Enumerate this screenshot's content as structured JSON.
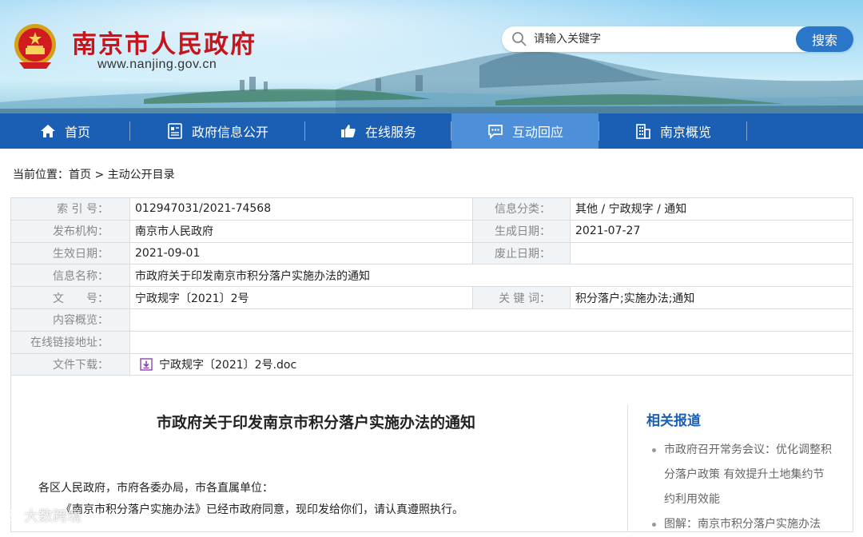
{
  "header": {
    "site_title": "南京市人民政府",
    "site_url": "www.nanjing.gov.cn",
    "search_placeholder": "请输入关键字",
    "search_button": "搜索"
  },
  "nav": {
    "items": [
      {
        "label": "首页",
        "icon": "home-icon"
      },
      {
        "label": "政府信息公开",
        "icon": "document-icon"
      },
      {
        "label": "在线服务",
        "icon": "thumbs-up-icon"
      },
      {
        "label": "互动回应",
        "icon": "chat-icon"
      },
      {
        "label": "南京概览",
        "icon": "building-icon"
      }
    ],
    "active_index": 3
  },
  "breadcrumb": {
    "prefix": "当前位置：",
    "home": "首页",
    "separator": ">",
    "current": "主动公开目录"
  },
  "info": {
    "index_label": "索 引 号：",
    "index_value": "012947031/2021-74568",
    "category_label": "信息分类：",
    "category_value": "其他 / 宁政规字 / 通知",
    "publisher_label": "发布机构：",
    "publisher_value": "南京市人民政府",
    "created_label": "生成日期：",
    "created_value": "2021-07-27",
    "effective_label": "生效日期：",
    "effective_value": "2021-09-01",
    "repealed_label": "废止日期：",
    "repealed_value": "",
    "name_label": "信息名称：",
    "name_value": "市政府关于印发南京市积分落户实施办法的通知",
    "docno_label": "文　　号：",
    "docno_value": "宁政规字〔2021〕2号",
    "keywords_label": "关 键 词：",
    "keywords_value": "积分落户;实施办法;通知",
    "summary_label": "内容概览：",
    "summary_value": "",
    "link_label": "在线链接地址：",
    "link_value": "",
    "download_label": "文件下载：",
    "download_value": "宁政规字〔2021〕2号.doc"
  },
  "document": {
    "title": "市政府关于印发南京市积分落户实施办法的通知",
    "para1": "各区人民政府，市府各委办局，市各直属单位：",
    "para2": "《南京市积分落户实施办法》已经市政府同意，现印发给你们，请认真遵照执行。"
  },
  "related": {
    "title": "相关报道",
    "items": [
      "市政府召开常务会议：优化调整积分落户政策 有效提升土地集约节约利用效能",
      "图解：南京市积分落户实施办法"
    ]
  },
  "watermark": "大数跨境",
  "colors": {
    "brand_red": "#c4161c",
    "nav_blue": "#1a5fb4",
    "nav_active": "#4d8fd8",
    "search_blue": "#2a77c9",
    "label_bg": "#f1f4f7"
  }
}
